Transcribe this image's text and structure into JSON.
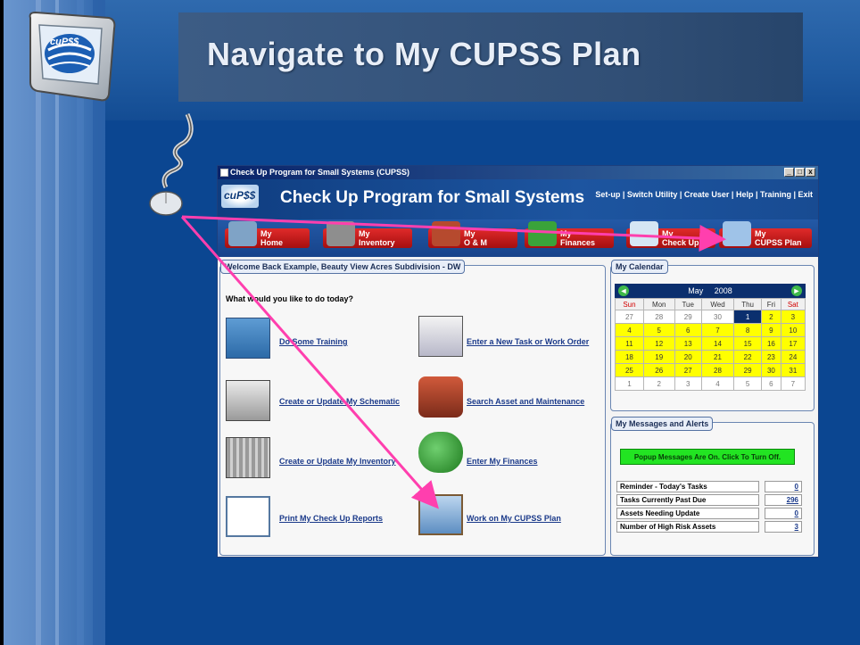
{
  "slide": {
    "title": "Navigate to My CUPSS Plan",
    "logo_text": "cuP$$",
    "colors": {
      "background": "#0b4691",
      "arrow": "#ff3fae",
      "title_box": "#3c5c85"
    }
  },
  "window": {
    "title": "Check Up Program for Small Systems (CUPSS)",
    "controls": [
      "_",
      "□",
      "x"
    ]
  },
  "app": {
    "logo": "cuP$$",
    "name": "Check Up Program for Small Systems",
    "links": "Set-up | Switch Utility | Create User | Help | Training | Exit"
  },
  "nav": [
    {
      "line1": "My",
      "line2": "Home",
      "icon": "house-icon"
    },
    {
      "line1": "My",
      "line2": "Inventory",
      "icon": "inventory-icon"
    },
    {
      "line1": "My",
      "line2": "O & M",
      "icon": "wrench-icon"
    },
    {
      "line1": "My",
      "line2": "Finances",
      "icon": "money-bag-icon"
    },
    {
      "line1": "My",
      "line2": "Check Up",
      "icon": "checkup-icon"
    },
    {
      "line1": "My",
      "line2": "CUPSS Plan",
      "icon": "plan-sign-icon"
    }
  ],
  "welcome": {
    "header": "Welcome Back Example, Beauty View Acres Subdivision - DW",
    "question": "What would you like to do today?",
    "actions": [
      "Do Some Training",
      "Enter a New Task or Work Order",
      "Create or Update My Schematic",
      "Search Asset and Maintenance",
      "Create or Update My Inventory",
      "Enter My Finances",
      "Print My Check Up Reports",
      "Work on My CUPSS Plan"
    ]
  },
  "calendar": {
    "header": "My Calendar",
    "month": "May",
    "year": "2008",
    "days": [
      "Sun",
      "Mon",
      "Tue",
      "Wed",
      "Thu",
      "Fri",
      "Sat"
    ],
    "weeks": [
      [
        "27",
        "28",
        "29",
        "30",
        "1",
        "2",
        "3"
      ],
      [
        "4",
        "5",
        "6",
        "7",
        "8",
        "9",
        "10"
      ],
      [
        "11",
        "12",
        "13",
        "14",
        "15",
        "16",
        "17"
      ],
      [
        "18",
        "19",
        "20",
        "21",
        "22",
        "23",
        "24"
      ],
      [
        "25",
        "26",
        "27",
        "28",
        "29",
        "30",
        "31"
      ],
      [
        "1",
        "2",
        "3",
        "4",
        "5",
        "6",
        "7"
      ]
    ]
  },
  "messages": {
    "header": "My Messages and Alerts",
    "popup_button": "Popup Messages Are On. Click To Turn Off.",
    "alerts": [
      {
        "label": "Reminder - Today's Tasks",
        "value": "0"
      },
      {
        "label": "Tasks Currently Past Due",
        "value": "296"
      },
      {
        "label": "Assets Needing Update",
        "value": "0"
      },
      {
        "label": "Number of High Risk Assets",
        "value": "3"
      }
    ]
  }
}
